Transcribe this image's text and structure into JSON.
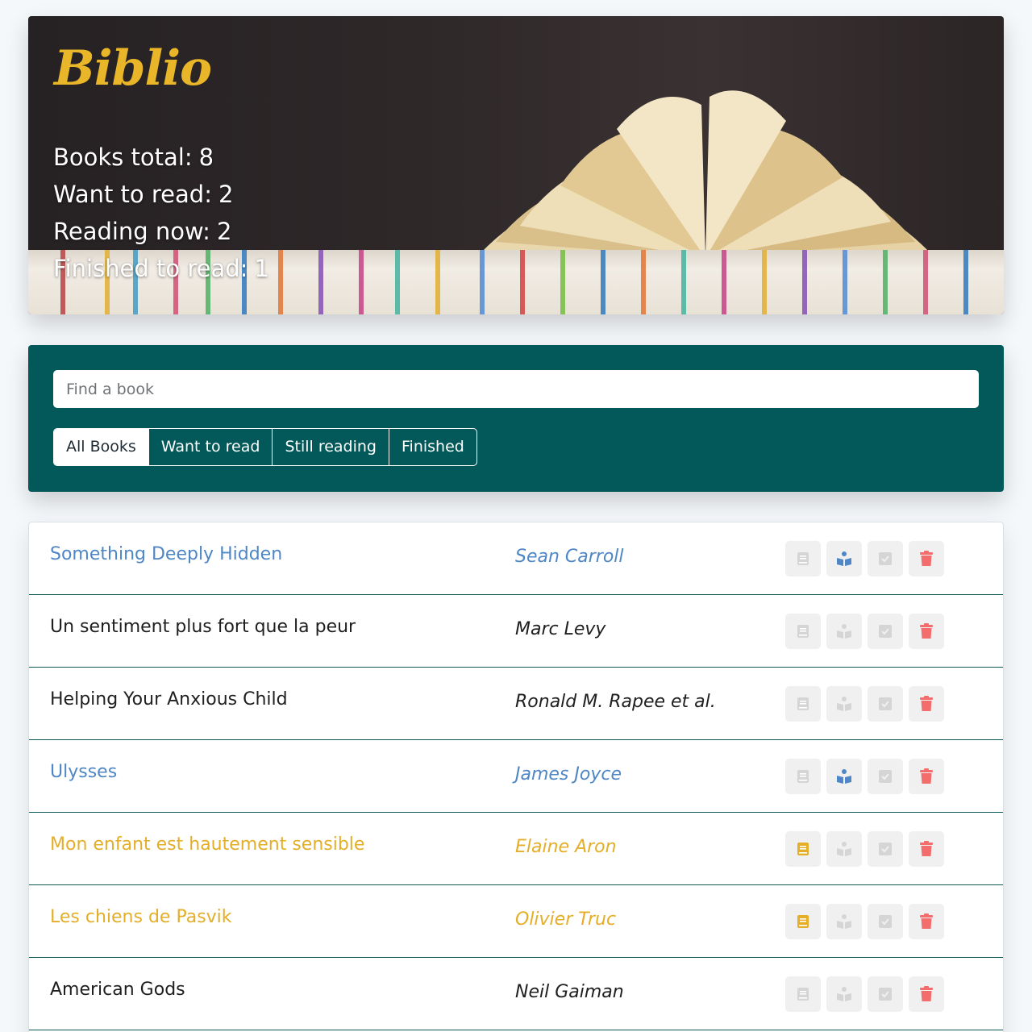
{
  "header": {
    "logo": "Biblio",
    "stats": [
      {
        "label": "Books total:",
        "value": "8"
      },
      {
        "label": "Want to read:",
        "value": "2"
      },
      {
        "label": "Reading now:",
        "value": "2"
      },
      {
        "label": "Finished to read:",
        "value": "1"
      }
    ]
  },
  "search": {
    "placeholder": "Find a book",
    "value": ""
  },
  "tabs": [
    {
      "label": "All Books",
      "active": true
    },
    {
      "label": "Want to read",
      "active": false
    },
    {
      "label": "Still reading",
      "active": false
    },
    {
      "label": "Finished",
      "active": false
    }
  ],
  "books": [
    {
      "title": "Something Deeply Hidden",
      "author": "Sean Carroll",
      "status": "reading"
    },
    {
      "title": "Un sentiment plus fort que la peur",
      "author": "Marc Levy",
      "status": "none"
    },
    {
      "title": "Helping Your Anxious Child",
      "author": "Ronald M. Rapee et al.",
      "status": "none"
    },
    {
      "title": "Ulysses",
      "author": "James Joyce",
      "status": "reading"
    },
    {
      "title": "Mon enfant est hautement sensible",
      "author": "Elaine Aron",
      "status": "want"
    },
    {
      "title": "Les chiens de Pasvik",
      "author": "Olivier Truc",
      "status": "want"
    },
    {
      "title": "American Gods",
      "author": "Neil Gaiman",
      "status": "none"
    }
  ],
  "colors": {
    "accent_teal": "#03585a",
    "logo_gold": "#e8b628",
    "reading_blue": "#4f87c6",
    "want_gold": "#e4ae28",
    "delete_red": "#f36d6d",
    "inactive_icon": "#d5d5d5"
  },
  "icons": {
    "want": "book-icon",
    "reading": "reader-icon",
    "finished": "check-square-icon",
    "delete": "trash-icon"
  }
}
